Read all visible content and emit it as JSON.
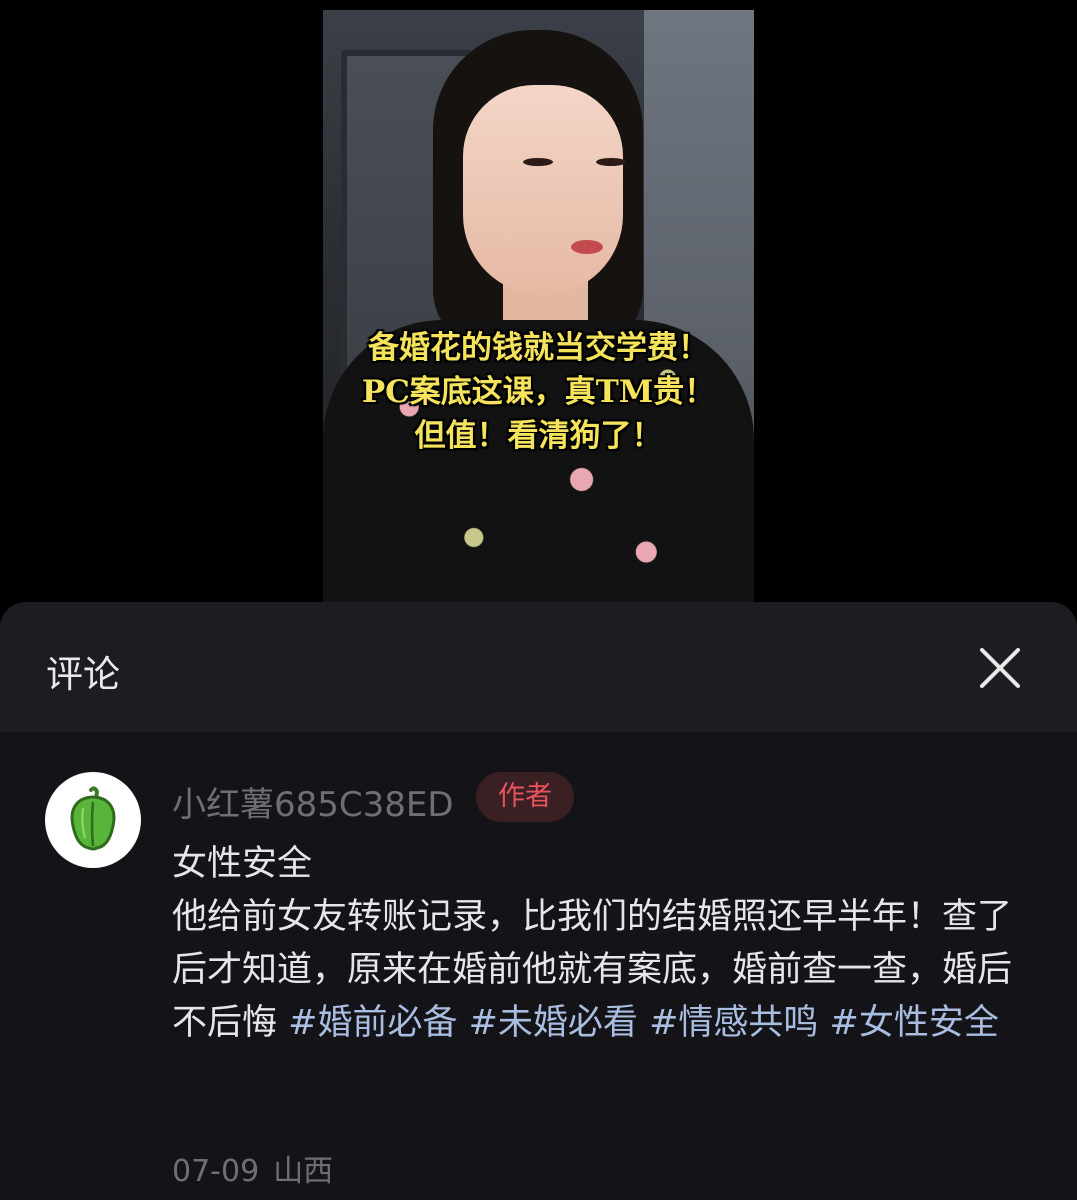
{
  "video": {
    "caption_lines": [
      "备婚花的钱就当交学费！",
      "PC案底这课，真TM贵！",
      "但值！看清狗了！"
    ]
  },
  "sheet": {
    "title": "评论",
    "close_icon": "close-icon"
  },
  "comment": {
    "avatar_icon": "green-pepper-icon",
    "username": "小红薯685C38ED",
    "badge": "作者",
    "body_line1": "女性安全",
    "body_text": "他给前女友转账记录，比我们的结婚照还早半年！查了后才知道，原来在婚前他就有案底，婚前查一查，婚后不后悔 ",
    "hashtags": [
      "#婚前必备",
      "#未婚必看",
      "#情感共鸣",
      "#女性安全"
    ],
    "date": "07-09",
    "location": "山西"
  },
  "colors": {
    "caption": "#f4e35b",
    "author_badge_text": "#e8545e",
    "hashtag": "#a9bde0",
    "sheet_bg": "#141418"
  }
}
